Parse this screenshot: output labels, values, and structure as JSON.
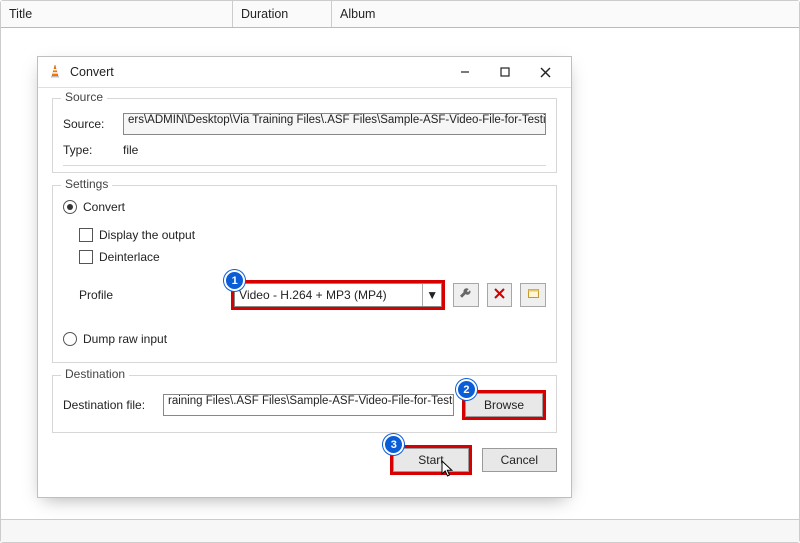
{
  "table_headers": {
    "title": "Title",
    "duration": "Duration",
    "album": "Album"
  },
  "dialog": {
    "title": "Convert",
    "source": {
      "legend": "Source",
      "source_label": "Source:",
      "source_value": "ers\\ADMIN\\Desktop\\Via Training Files\\.ASF Files\\Sample-ASF-Video-File-for-Testing.asf",
      "type_label": "Type:",
      "type_value": "file"
    },
    "settings": {
      "legend": "Settings",
      "convert_label": "Convert",
      "display_output_label": "Display the output",
      "deinterlace_label": "Deinterlace",
      "profile_label": "Profile",
      "profile_value": "Video - H.264 + MP3 (MP4)",
      "dump_raw_label": "Dump raw input"
    },
    "destination": {
      "legend": "Destination",
      "file_label": "Destination file:",
      "file_value": "raining Files\\.ASF Files\\Sample-ASF-Video-File-for-Testing.asf",
      "browse_label": "Browse"
    },
    "actions": {
      "start_label": "Start",
      "cancel_label": "Cancel"
    }
  },
  "annotations": {
    "badge1": "1",
    "badge2": "2",
    "badge3": "3"
  },
  "icons": {
    "wrench": "wrench-icon",
    "delete": "delete-icon",
    "new_profile": "new-profile-icon",
    "dropdown": "▼"
  }
}
